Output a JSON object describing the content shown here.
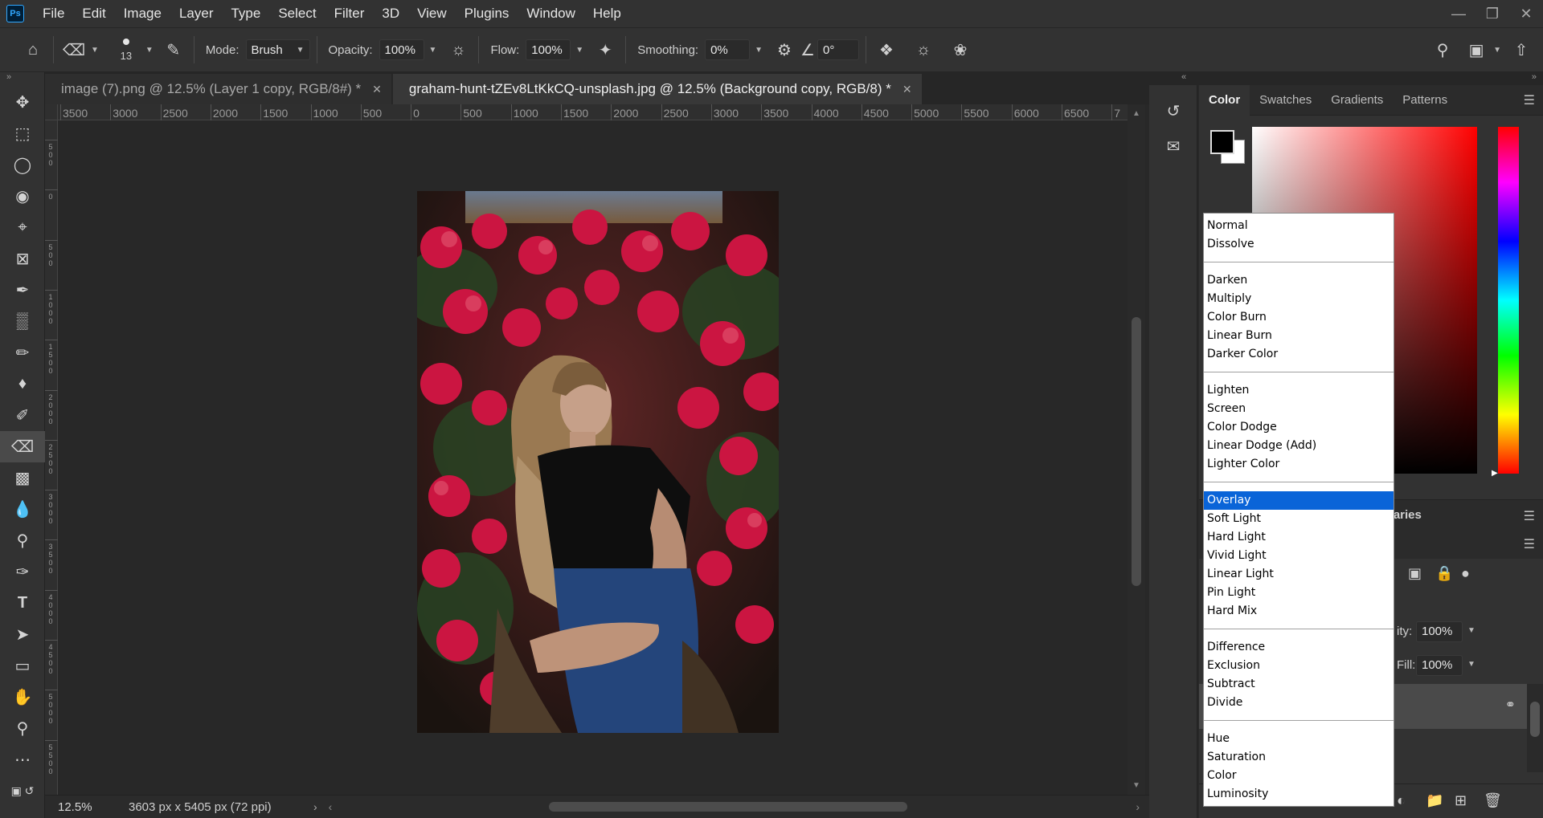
{
  "app": {
    "logo_text": "Ps"
  },
  "menu": [
    "File",
    "Edit",
    "Image",
    "Layer",
    "Type",
    "Select",
    "Filter",
    "3D",
    "View",
    "Plugins",
    "Window",
    "Help"
  ],
  "window_controls": [
    "minimize",
    "restore",
    "close"
  ],
  "options_bar": {
    "brush_size": "13",
    "mode_label": "Mode:",
    "mode_value": "Brush",
    "opacity_label": "Opacity:",
    "opacity_value": "100%",
    "flow_label": "Flow:",
    "flow_value": "100%",
    "smoothing_label": "Smoothing:",
    "smoothing_value": "0%",
    "angle_value": "0°"
  },
  "tabs": [
    {
      "title": "image (7).png @ 12.5% (Layer 1 copy, RGB/8#) *",
      "active": false
    },
    {
      "title": "graham-hunt-tZEv8LtKkCQ-unsplash.jpg @ 12.5% (Background copy, RGB/8) *",
      "active": true
    }
  ],
  "ruler_top_labels": [
    "3500",
    "3000",
    "2500",
    "2000",
    "1500",
    "1000",
    "500",
    "0",
    "500",
    "1000",
    "1500",
    "2000",
    "2500",
    "3000",
    "3500",
    "4000",
    "4500",
    "5000",
    "5500",
    "6000",
    "6500",
    "7"
  ],
  "ruler_left_labels": [
    "500",
    "0",
    "500",
    "1000",
    "1500",
    "2000",
    "2500",
    "3000",
    "3500",
    "4000",
    "4500",
    "5000",
    "5500"
  ],
  "status": {
    "zoom": "12.5%",
    "doc_info": "3603 px x 5405 px (72 ppi)"
  },
  "color_panel": {
    "tabs": [
      "Color",
      "Swatches",
      "Gradients",
      "Patterns"
    ],
    "active_tab": "Color",
    "foreground": "#000000",
    "background": "#ffffff"
  },
  "libraries_label": "raries",
  "layers_panel": {
    "opacity_label": "ity:",
    "opacity_value": "100%",
    "fill_label": "Fill:",
    "fill_value": "100%"
  },
  "blend_modes": {
    "groups": [
      [
        "Normal",
        "Dissolve"
      ],
      [
        "Darken",
        "Multiply",
        "Color Burn",
        "Linear Burn",
        "Darker Color"
      ],
      [
        "Lighten",
        "Screen",
        "Color Dodge",
        "Linear Dodge (Add)",
        "Lighter Color"
      ],
      [
        "Overlay",
        "Soft Light",
        "Hard Light",
        "Vivid Light",
        "Linear Light",
        "Pin Light",
        "Hard Mix"
      ],
      [
        "Difference",
        "Exclusion",
        "Subtract",
        "Divide"
      ],
      [
        "Hue",
        "Saturation",
        "Color",
        "Luminosity"
      ]
    ],
    "selected": "Overlay"
  }
}
